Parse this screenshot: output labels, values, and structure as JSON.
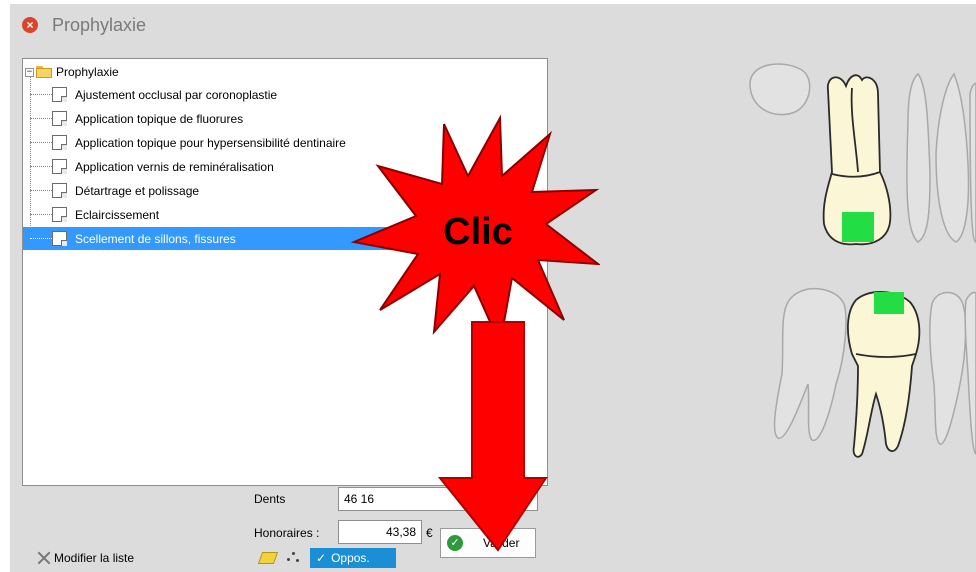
{
  "window": {
    "title": "Prophylaxie"
  },
  "tree": {
    "root_label": "Prophylaxie",
    "items": [
      {
        "label": "Ajustement occlusal par coronoplastie",
        "selected": false
      },
      {
        "label": "Application topique de fluorures",
        "selected": false
      },
      {
        "label": "Application topique pour hypersensibilité dentinaire",
        "selected": false
      },
      {
        "label": "Application vernis de reminéralisation",
        "selected": false
      },
      {
        "label": "Détartrage et polissage",
        "selected": false
      },
      {
        "label": "Eclaircissement",
        "selected": false
      },
      {
        "label": "Scellement de sillons, fissures",
        "selected": true
      }
    ]
  },
  "form": {
    "dents_label": "Dents",
    "dents_value": "46 16",
    "honoraires_label": "Honoraires :",
    "honoraires_value": "43,38",
    "currency": "€"
  },
  "buttons": {
    "valider": "Valider",
    "modify_list": "Modifier la liste",
    "oppos": "Oppos."
  },
  "annotation": {
    "callout_text": "Clic"
  },
  "colors": {
    "selection": "#3399ff",
    "callout_red": "#ff0000",
    "tooth_highlight": "#22dd44",
    "oppos_badge": "#1a8fd6",
    "valider_check": "#2e9b3a"
  }
}
